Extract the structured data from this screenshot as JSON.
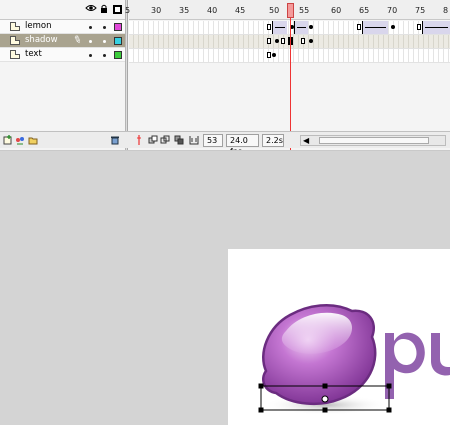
{
  "timeline": {
    "ruler_ticks": [
      "5",
      "30",
      "35",
      "40",
      "45",
      "50",
      "55",
      "60",
      "65",
      "70",
      "75",
      "8"
    ],
    "layers": [
      {
        "name": "lemon",
        "selected": false,
        "color": "#e048d8"
      },
      {
        "name": "shadow",
        "selected": true,
        "color": "#36d0e0"
      },
      {
        "name": "text",
        "selected": false,
        "color": "#3ccc3c"
      }
    ],
    "current_frame": "53",
    "frame_rate": "24.0 fps",
    "elapsed_time": "2.2s"
  },
  "stage": {
    "logo_text": "pu",
    "colors": {
      "lemon_fill": "#9a4fb0",
      "lemon_highlight": "#e2b6ea",
      "logo_purple": "#8a55a8",
      "playhead": "#e33333"
    }
  }
}
